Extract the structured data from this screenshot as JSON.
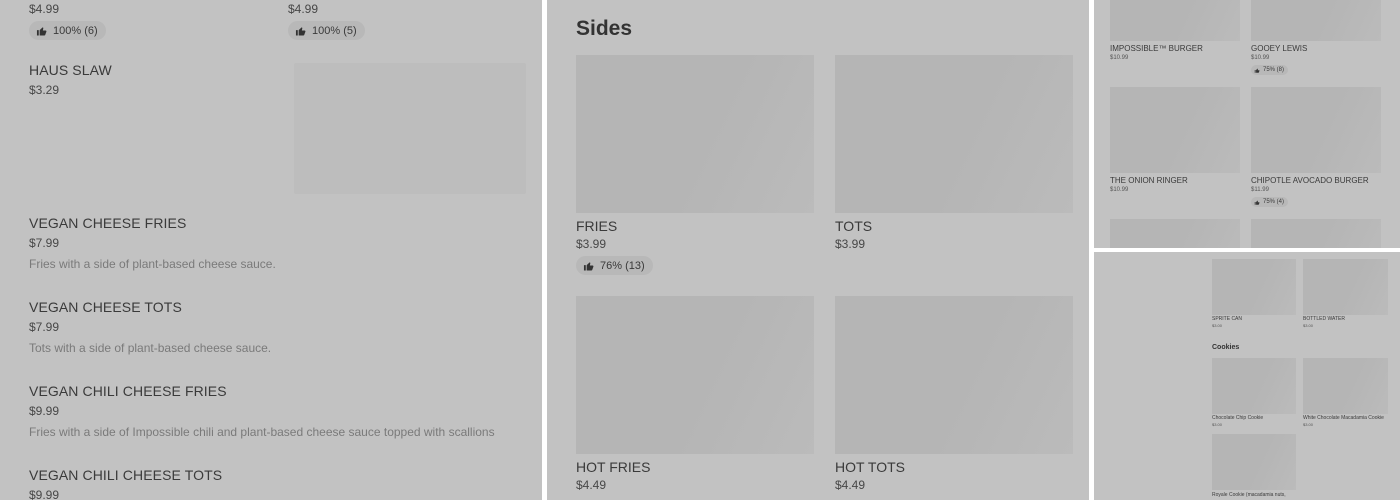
{
  "panel1": {
    "top_prices": [
      "$4.99",
      "$4.99"
    ],
    "top_badges": [
      "100% (6)",
      "100% (5)"
    ],
    "items": [
      {
        "name": "HAUS SLAW",
        "price": "$3.29"
      },
      {
        "name": "VEGAN CHEESE FRIES",
        "price": "$7.99",
        "desc": "Fries with a side of plant-based cheese sauce."
      },
      {
        "name": "VEGAN CHEESE TOTS",
        "price": "$7.99",
        "desc": "Tots with a side of plant-based cheese sauce."
      },
      {
        "name": "VEGAN CHILI CHEESE FRIES",
        "price": "$9.99",
        "desc": "Fries with a side of Impossible chili and plant-based cheese sauce topped with scallions"
      },
      {
        "name": "VEGAN CHILI CHEESE TOTS",
        "price": "$9.99"
      }
    ]
  },
  "panel2": {
    "section_title": "Sides",
    "items": [
      {
        "name": "FRIES",
        "price": "$3.99",
        "badge": "76% (13)"
      },
      {
        "name": "TOTS",
        "price": "$3.99"
      },
      {
        "name": "HOT FRIES",
        "price": "$4.49"
      },
      {
        "name": "HOT TOTS",
        "price": "$4.49"
      }
    ]
  },
  "panel3": {
    "items": [
      {
        "name": "IMPOSSIBLE™ BURGER",
        "price": "$10.99"
      },
      {
        "name": "GOOEY LEWIS",
        "price": "$10.99",
        "badge": "75% (8)"
      },
      {
        "name": "THE ONION RINGER",
        "price": "$10.99"
      },
      {
        "name": "CHIPOTLE AVOCADO BURGER",
        "price": "$11.99",
        "badge": "75% (4)"
      }
    ]
  },
  "panel4": {
    "drinks": [
      {
        "name": "SPRITE CAN",
        "price": "$3.00"
      },
      {
        "name": "BOTTLED WATER",
        "price": "$3.00"
      }
    ],
    "section_title": "Cookies",
    "cookies": [
      {
        "name": "Chocolate Chip Cookie",
        "price": "$3.00"
      },
      {
        "name": "White Chocolate Macadamia Cookie",
        "price": "$3.00"
      },
      {
        "name": "Royale Cookie (macadamia nuts,"
      }
    ]
  },
  "icons": {
    "rating": "thumbs-up-icon"
  }
}
